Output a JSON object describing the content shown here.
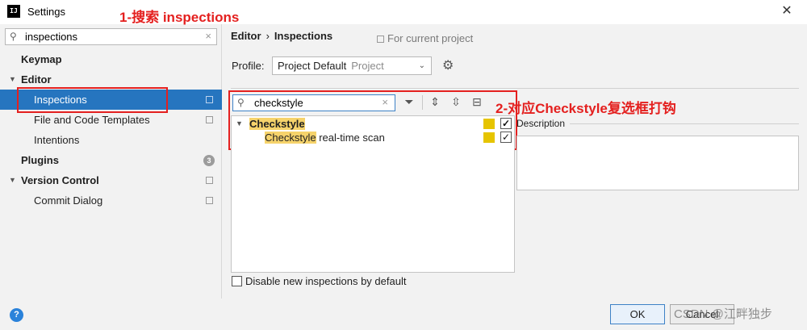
{
  "window": {
    "title": "Settings",
    "close": "✕"
  },
  "annotations": {
    "a1": "1-搜索 inspections",
    "a2": "2-对应Checkstyle复选框打钩"
  },
  "sidebar": {
    "search_value": "inspections",
    "items": [
      {
        "label": "Keymap"
      },
      {
        "label": "Editor"
      },
      {
        "label": "Inspections"
      },
      {
        "label": "File and Code Templates"
      },
      {
        "label": "Intentions"
      },
      {
        "label": "Plugins",
        "badge": "3"
      },
      {
        "label": "Version Control"
      },
      {
        "label": "Commit Dialog"
      }
    ]
  },
  "breadcrumb": {
    "parent": "Editor",
    "sep": "›",
    "current": "Inspections",
    "scope": "For current project"
  },
  "profile": {
    "label": "Profile:",
    "value": "Project Default",
    "sub": "Project"
  },
  "filter": {
    "value": "checkstyle"
  },
  "inspections": [
    {
      "label_hl": "Checkstyle",
      "label_rest": "",
      "checked": true
    },
    {
      "label_hl": "Checkstyle",
      "label_rest": " real-time scan",
      "checked": true
    }
  ],
  "description": {
    "label": "Description"
  },
  "disable_new": {
    "label": "Disable new inspections by default"
  },
  "buttons": {
    "ok": "OK",
    "cancel": "Cancel"
  },
  "watermark": "CSDN @江畔独步",
  "icons": {
    "help": "?",
    "checkmark": "✓",
    "gear": "⚙"
  },
  "colors": {
    "selection": "#2675bf",
    "annotation": "#e4201f",
    "highlight": "#f6d36b",
    "severity": "#e6c400"
  }
}
